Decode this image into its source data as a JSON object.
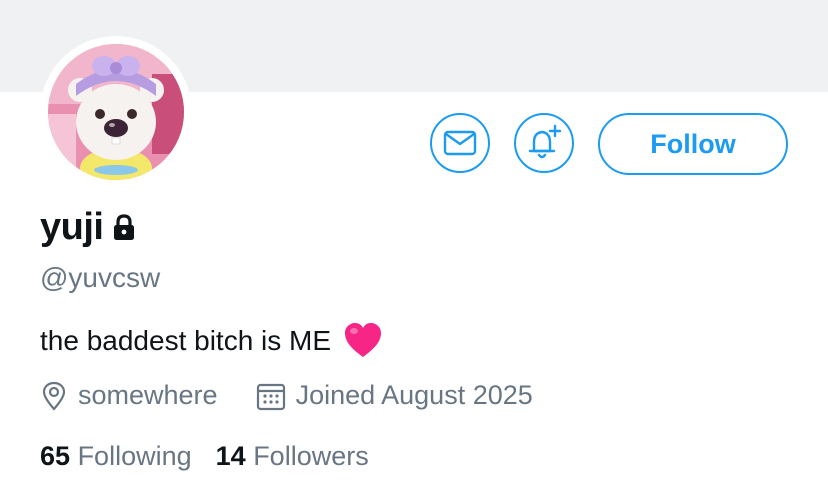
{
  "profile": {
    "name": "yuji",
    "handle": "@yuvcsw",
    "bio": "the baddest bitch is ME",
    "location": "somewhere",
    "joined": "Joined August 2025"
  },
  "actions": {
    "follow_label": "Follow",
    "message_icon": "envelope-icon",
    "notify_icon": "bell-plus-icon"
  },
  "stats": {
    "following_count": "65",
    "following_label": "Following",
    "followers_count": "14",
    "followers_label": "Followers"
  },
  "colors": {
    "accent": "#1d9bf0",
    "banner": "#eff1f3",
    "secondary_text": "#687684",
    "heart": "#f72585"
  }
}
